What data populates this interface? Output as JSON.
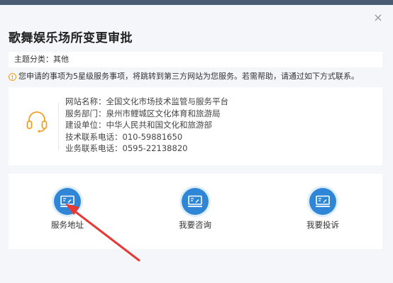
{
  "dialog": {
    "title": "歌舞娱乐场所变更审批",
    "close_glyph": "×",
    "subject": "主题分类：其他",
    "notice": "您申请的事项为5星级服务事项，将跳转到第三方网站为您服务。若需帮助，请通过如下方式联系。",
    "notice_icon": "info-circle-icon"
  },
  "contact": {
    "icon": "headset-icon",
    "lines": [
      "网站名称：全国文化市场技术监管与服务平台",
      "服务部门：泉州市鲤城区文化体育和旅游局",
      "建设单位：中华人民共和国文化和旅游部",
      "技术联系电话：010-59881650",
      "业务联系电话：0595-22138820"
    ]
  },
  "actions": [
    {
      "label": "服务地址",
      "icon": "monitor-icon"
    },
    {
      "label": "我要咨询",
      "icon": "monitor-icon"
    },
    {
      "label": "我要投诉",
      "icon": "monitor-icon"
    }
  ],
  "colors": {
    "accent": "#2f86d6",
    "warning": "#f0a020",
    "annotation_arrow": "#e53935"
  }
}
